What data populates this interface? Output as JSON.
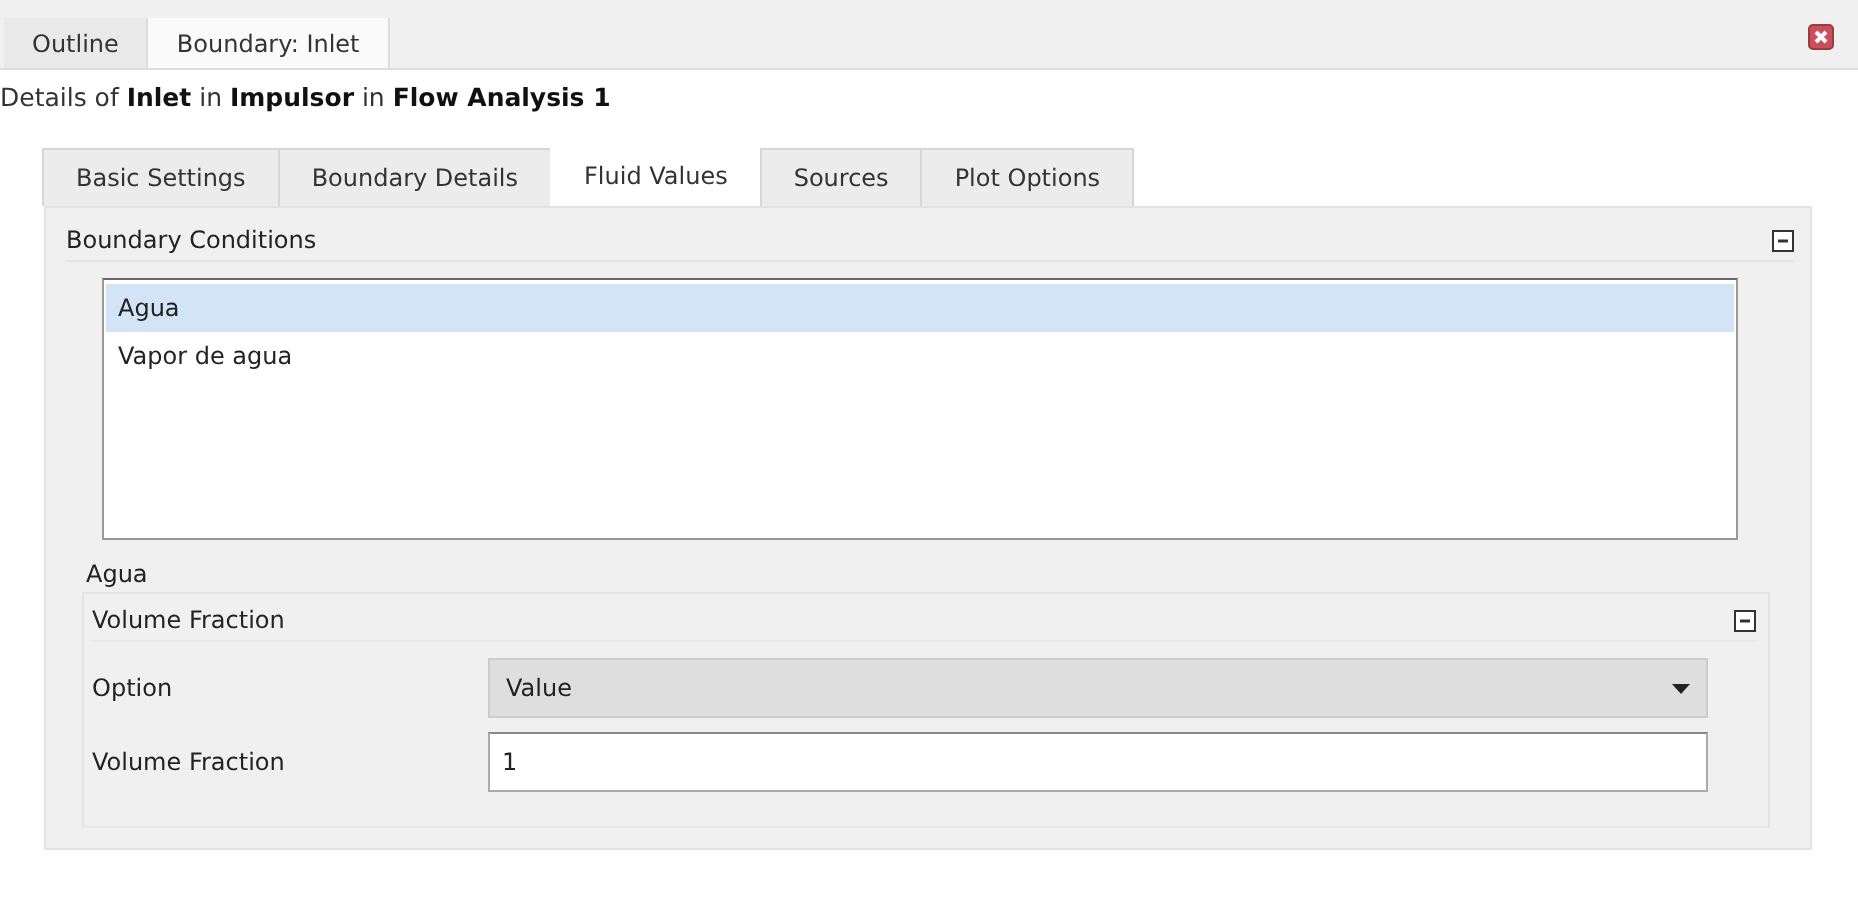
{
  "outer_tabs": [
    {
      "label": "Outline",
      "selected": false
    },
    {
      "label": "Boundary: Inlet",
      "selected": true
    }
  ],
  "details_title": "Details of **Inlet** in **Impulsor** in **Flow Analysis 1**",
  "tabs": [
    {
      "label": "Basic Settings",
      "selected": false
    },
    {
      "label": "Boundary Details",
      "selected": false
    },
    {
      "label": "Fluid Values",
      "selected": true
    },
    {
      "label": "Sources",
      "selected": false
    },
    {
      "label": "Plot Options",
      "selected": false
    }
  ],
  "boundary_conditions": {
    "title": "Boundary Conditions",
    "expanded": true,
    "items": [
      {
        "label": "Agua",
        "selected": true
      },
      {
        "label": "Vapor de agua",
        "selected": false
      }
    ]
  },
  "fluid_section": {
    "title": "Agua",
    "group": {
      "title": "Volume Fraction",
      "expanded": true,
      "option": {
        "label": "Option",
        "value": "Value"
      },
      "volume_fraction": {
        "label": "Volume Fraction",
        "value": "1"
      }
    }
  }
}
